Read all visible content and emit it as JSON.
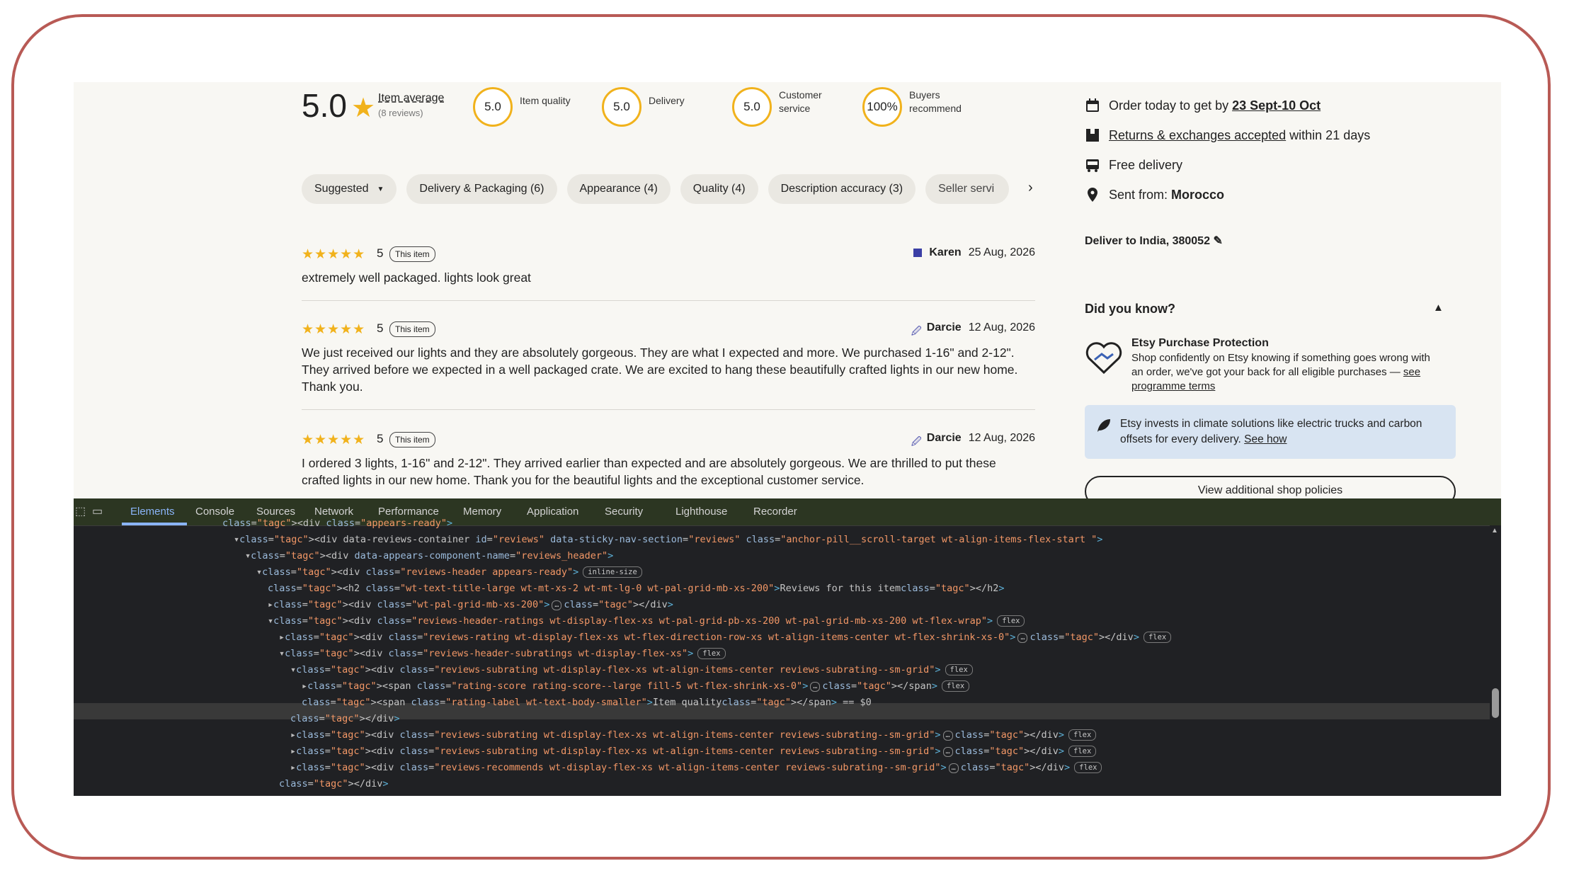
{
  "rating_header": {
    "average": "5.0",
    "average_label": "Item average",
    "review_count": "(8 reviews)",
    "subratings": [
      {
        "score": "5.0",
        "label": "Item quality"
      },
      {
        "score": "5.0",
        "label": "Delivery"
      },
      {
        "score": "5.0",
        "label": "Customer service"
      },
      {
        "score": "100%",
        "label": "Buyers recommend"
      }
    ]
  },
  "filters": {
    "sort": "Suggested",
    "pills": [
      "Delivery & Packaging (6)",
      "Appearance (4)",
      "Quality (4)",
      "Description accuracy (3)"
    ],
    "truncated_pill": "Seller servi"
  },
  "reviews": [
    {
      "stars": "★★★★★",
      "rating": "5",
      "tag": "This item",
      "author": "Karen",
      "date": "25 Aug, 2026",
      "text": "extremely well packaged. lights look great"
    },
    {
      "stars": "★★★★★",
      "rating": "5",
      "tag": "This item",
      "author": "Darcie",
      "date": "12 Aug, 2026",
      "text": "We just received our lights and they are absolutely gorgeous. They are what I expected and more. We purchased 1-16\" and 2-12\". They arrived before we expected in a well packaged crate. We are excited to hang these beautifully crafted lights in our new home. Thank you."
    },
    {
      "stars": "★★★★★",
      "rating": "5",
      "tag": "This item",
      "author": "Darcie",
      "date": "12 Aug, 2026",
      "text": "I ordered 3 lights, 1-16\" and 2-12\". They arrived earlier than expected and are absolutely gorgeous. We are thrilled to put these crafted lights in our new home. Thank you for the beautiful lights and the exceptional customer service."
    }
  ],
  "shipping": {
    "order_prefix": "Order today to get by ",
    "order_dates": "23 Sept-10 Oct",
    "returns_link": "Returns & exchanges accepted",
    "returns_suffix": " within 21 days",
    "free_delivery": "Free delivery",
    "sent_from_label": "Sent from: ",
    "sent_from_value": "Morocco",
    "deliver_to": "Deliver to India, 380052"
  },
  "did_you_know": {
    "heading": "Did you know?",
    "protection_title": "Etsy Purchase Protection",
    "protection_text": "Shop confidently on Etsy knowing if something goes wrong with an order, we've got your back for all eligible purchases — ",
    "protection_link": "see programme terms",
    "climate_text": "Etsy invests in climate solutions like electric trucks and carbon offsets for every delivery. ",
    "climate_link": "See how",
    "policies_button": "View additional shop policies"
  },
  "devtools": {
    "tabs": [
      "Elements",
      "Console",
      "Sources",
      "Network",
      "Performance",
      "Memory",
      "Application",
      "Security",
      "Lighthouse",
      "Recorder"
    ],
    "active_tab": "Elements",
    "dom_lines": [
      {
        "indent": 0,
        "html": "&lt;div class=\"appears-ready\"&gt;"
      },
      {
        "indent": 1,
        "html": "▾&lt;div data-reviews-container id=\"reviews\" data-sticky-nav-section=\"reviews\" class=\"anchor-pill__scroll-target wt-align-items-flex-start \"&gt;"
      },
      {
        "indent": 2,
        "html": "▾&lt;div data-appears-component-name=\"reviews_header\"&gt;"
      },
      {
        "indent": 3,
        "html": "▾&lt;div class=\"reviews-header appears-ready\"&gt;"
      },
      {
        "indent": 4,
        "html": "&lt;h2 class=\"wt-text-title-large wt-mt-xs-2 wt-mt-lg-0 wt-pal-grid-mb-xs-200\"&gt;Reviews for this item&lt;/h2&gt;"
      },
      {
        "indent": 4,
        "html": "▸&lt;div class=\"wt-pal-grid-mb-xs-200\"&gt;…&lt;/div&gt;"
      },
      {
        "indent": 4,
        "html": "▾&lt;div class=\"reviews-header-ratings wt-display-flex-xs wt-pal-grid-pb-xs-200 wt-pal-grid-mb-xs-200 wt-flex-wrap\"&gt;"
      },
      {
        "indent": 5,
        "html": "▸&lt;div class=\"reviews-rating wt-display-flex-xs wt-flex-direction-row-xs wt-align-items-center wt-flex-shrink-xs-0\"&gt;…&lt;/div&gt;"
      },
      {
        "indent": 5,
        "html": "▾&lt;div class=\"reviews-header-subratings wt-display-flex-xs\"&gt;"
      },
      {
        "indent": 6,
        "html": "▾&lt;div class=\"reviews-subrating wt-display-flex-xs wt-align-items-center reviews-subrating--sm-grid\"&gt;"
      },
      {
        "indent": 7,
        "html": "▸&lt;span class=\"rating-score rating-score--large fill-5 wt-flex-shrink-xs-0\"&gt;…&lt;/span&gt;"
      },
      {
        "indent": 7,
        "html": "&lt;span class=\"rating-label wt-text-body-smaller\"&gt;Item quality&lt;/span&gt; == $0"
      },
      {
        "indent": 6,
        "html": "&lt;/div&gt;"
      },
      {
        "indent": 6,
        "html": "▸&lt;div class=\"reviews-subrating wt-display-flex-xs wt-align-items-center reviews-subrating--sm-grid\"&gt;…&lt;/div&gt;"
      },
      {
        "indent": 6,
        "html": "▸&lt;div class=\"reviews-subrating wt-display-flex-xs wt-align-items-center reviews-subrating--sm-grid\"&gt;…&lt;/div&gt;"
      },
      {
        "indent": 6,
        "html": "▸&lt;div class=\"reviews-recommends wt-display-flex-xs wt-align-items-center reviews-subrating--sm-grid\"&gt;…&lt;/div&gt;"
      },
      {
        "indent": 5,
        "html": "&lt;/div&gt;"
      }
    ],
    "badges": {
      "inline_size": "inline-size",
      "flex": "flex"
    }
  },
  "colors": {
    "star": "#f1b21c",
    "frame": "#b85a55",
    "devtools_bg": "#202124",
    "accent_tab": "#8ab4f8"
  }
}
